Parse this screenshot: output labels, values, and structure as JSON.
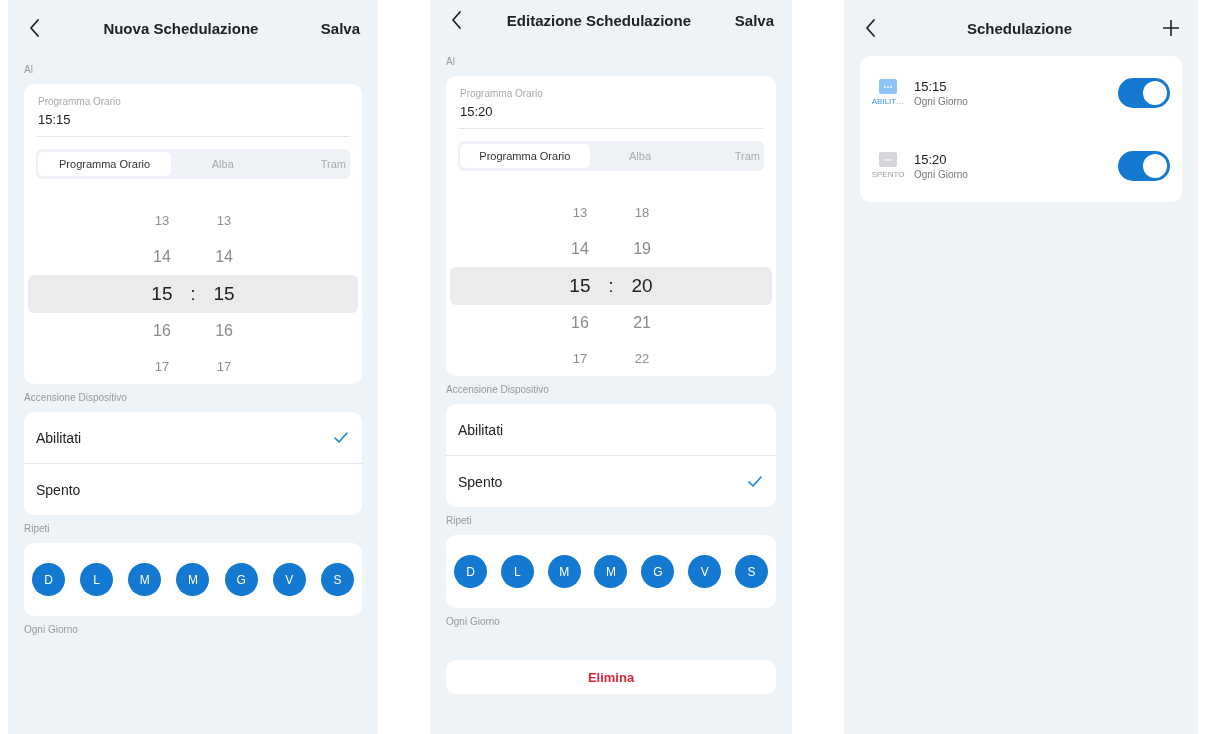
{
  "screens": [
    {
      "kind": "edit",
      "title": "Nuova Schedulazione",
      "action": "Salva",
      "time_label": "Al",
      "time_field": {
        "label": "Programma Orario",
        "value": "15:15"
      },
      "modes": [
        {
          "label": "Programma Orario",
          "selected": true
        },
        {
          "label": "Alba",
          "selected": false
        },
        {
          "label": "Tram",
          "selected": false
        }
      ],
      "picker": {
        "separator": ":",
        "hours": [
          {
            "label": "13",
            "selected": false
          },
          {
            "label": "14",
            "selected": false
          },
          {
            "label": "15",
            "selected": true
          },
          {
            "label": "16",
            "selected": false
          },
          {
            "label": "17",
            "selected": false
          }
        ],
        "minutes": [
          {
            "label": "13",
            "selected": false
          },
          {
            "label": "14",
            "selected": false
          },
          {
            "label": "15",
            "selected": true
          },
          {
            "label": "16",
            "selected": false
          },
          {
            "label": "17",
            "selected": false
          }
        ]
      },
      "power_label": "Accensione Dispositivo",
      "power_options": [
        {
          "label": "Abilitati",
          "selected": true
        },
        {
          "label": "Spento",
          "selected": false
        }
      ],
      "repeat_label": "Ripeti",
      "days": [
        {
          "label": "D",
          "selected": true
        },
        {
          "label": "L",
          "selected": true
        },
        {
          "label": "M",
          "selected": true
        },
        {
          "label": "M",
          "selected": true
        },
        {
          "label": "G",
          "selected": true
        },
        {
          "label": "V",
          "selected": true
        },
        {
          "label": "S",
          "selected": true
        }
      ],
      "repeat_summary": "Ogni Giorno"
    },
    {
      "kind": "edit",
      "title": "Editazione Schedulazione",
      "action": "Salva",
      "time_label": "Al",
      "time_field": {
        "label": "Programma Orario",
        "value": "15:20"
      },
      "modes": [
        {
          "label": "Programma Orario",
          "selected": true
        },
        {
          "label": "Alba",
          "selected": false
        },
        {
          "label": "Tram",
          "selected": false
        }
      ],
      "picker": {
        "separator": ":",
        "hours": [
          {
            "label": "13",
            "selected": false
          },
          {
            "label": "14",
            "selected": false
          },
          {
            "label": "15",
            "selected": true
          },
          {
            "label": "16",
            "selected": false
          },
          {
            "label": "17",
            "selected": false
          }
        ],
        "minutes": [
          {
            "label": "18",
            "selected": false
          },
          {
            "label": "19",
            "selected": false
          },
          {
            "label": "20",
            "selected": true
          },
          {
            "label": "21",
            "selected": false
          },
          {
            "label": "22",
            "selected": false
          }
        ]
      },
      "power_label": "Accensione Dispositivo",
      "power_options": [
        {
          "label": "Abilitati",
          "selected": false
        },
        {
          "label": "Spento",
          "selected": true
        }
      ],
      "repeat_label": "Ripeti",
      "days": [
        {
          "label": "D",
          "selected": true
        },
        {
          "label": "L",
          "selected": true
        },
        {
          "label": "M",
          "selected": true
        },
        {
          "label": "M",
          "selected": true
        },
        {
          "label": "G",
          "selected": true
        },
        {
          "label": "V",
          "selected": true
        },
        {
          "label": "S",
          "selected": true
        }
      ],
      "repeat_summary": "Ogni Giorno",
      "delete_button": "Elimina"
    },
    {
      "kind": "list",
      "title": "Schedulazione",
      "schedules": [
        {
          "status": "ABILIT…",
          "color": "#8cc4f5",
          "time": "15:15",
          "repeat": "Ogni Giorno",
          "on": true
        },
        {
          "status": "SPENTO",
          "color": "#d4d6d9",
          "time": "15:20",
          "repeat": "Ogni Giorno",
          "on": true
        }
      ]
    }
  ]
}
